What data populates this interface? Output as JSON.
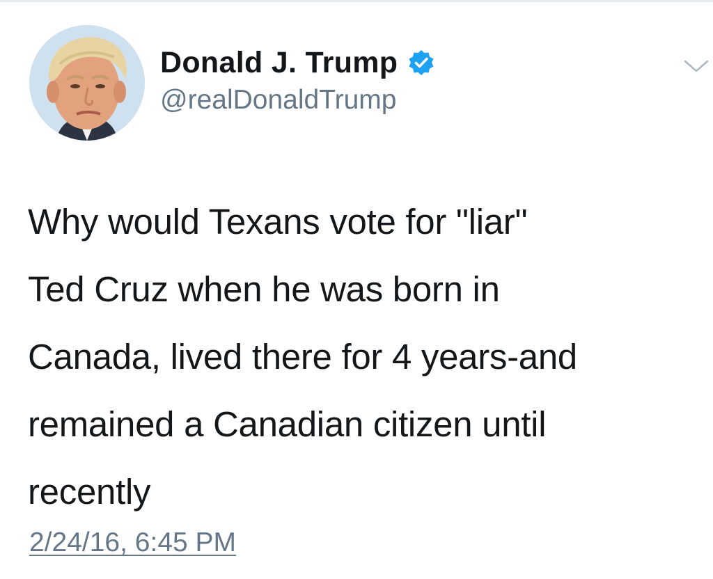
{
  "tweet": {
    "author": {
      "display_name": "Donald J. Trump",
      "handle": "@realDonaldTrump",
      "verified": true,
      "avatar_icon": "profile-photo"
    },
    "text": "Why would Texans vote for \"liar\"\nTed Cruz when he was born in\nCanada, lived there for 4 years-and\nremained a Canadian citizen until\nrecently",
    "timestamp": "2/24/16, 6:45 PM",
    "menu_icon": "chevron-down-icon"
  },
  "colors": {
    "text_primary": "#14171a",
    "text_secondary": "#657786",
    "verified_blue": "#1da1f2",
    "background": "#ffffff"
  }
}
